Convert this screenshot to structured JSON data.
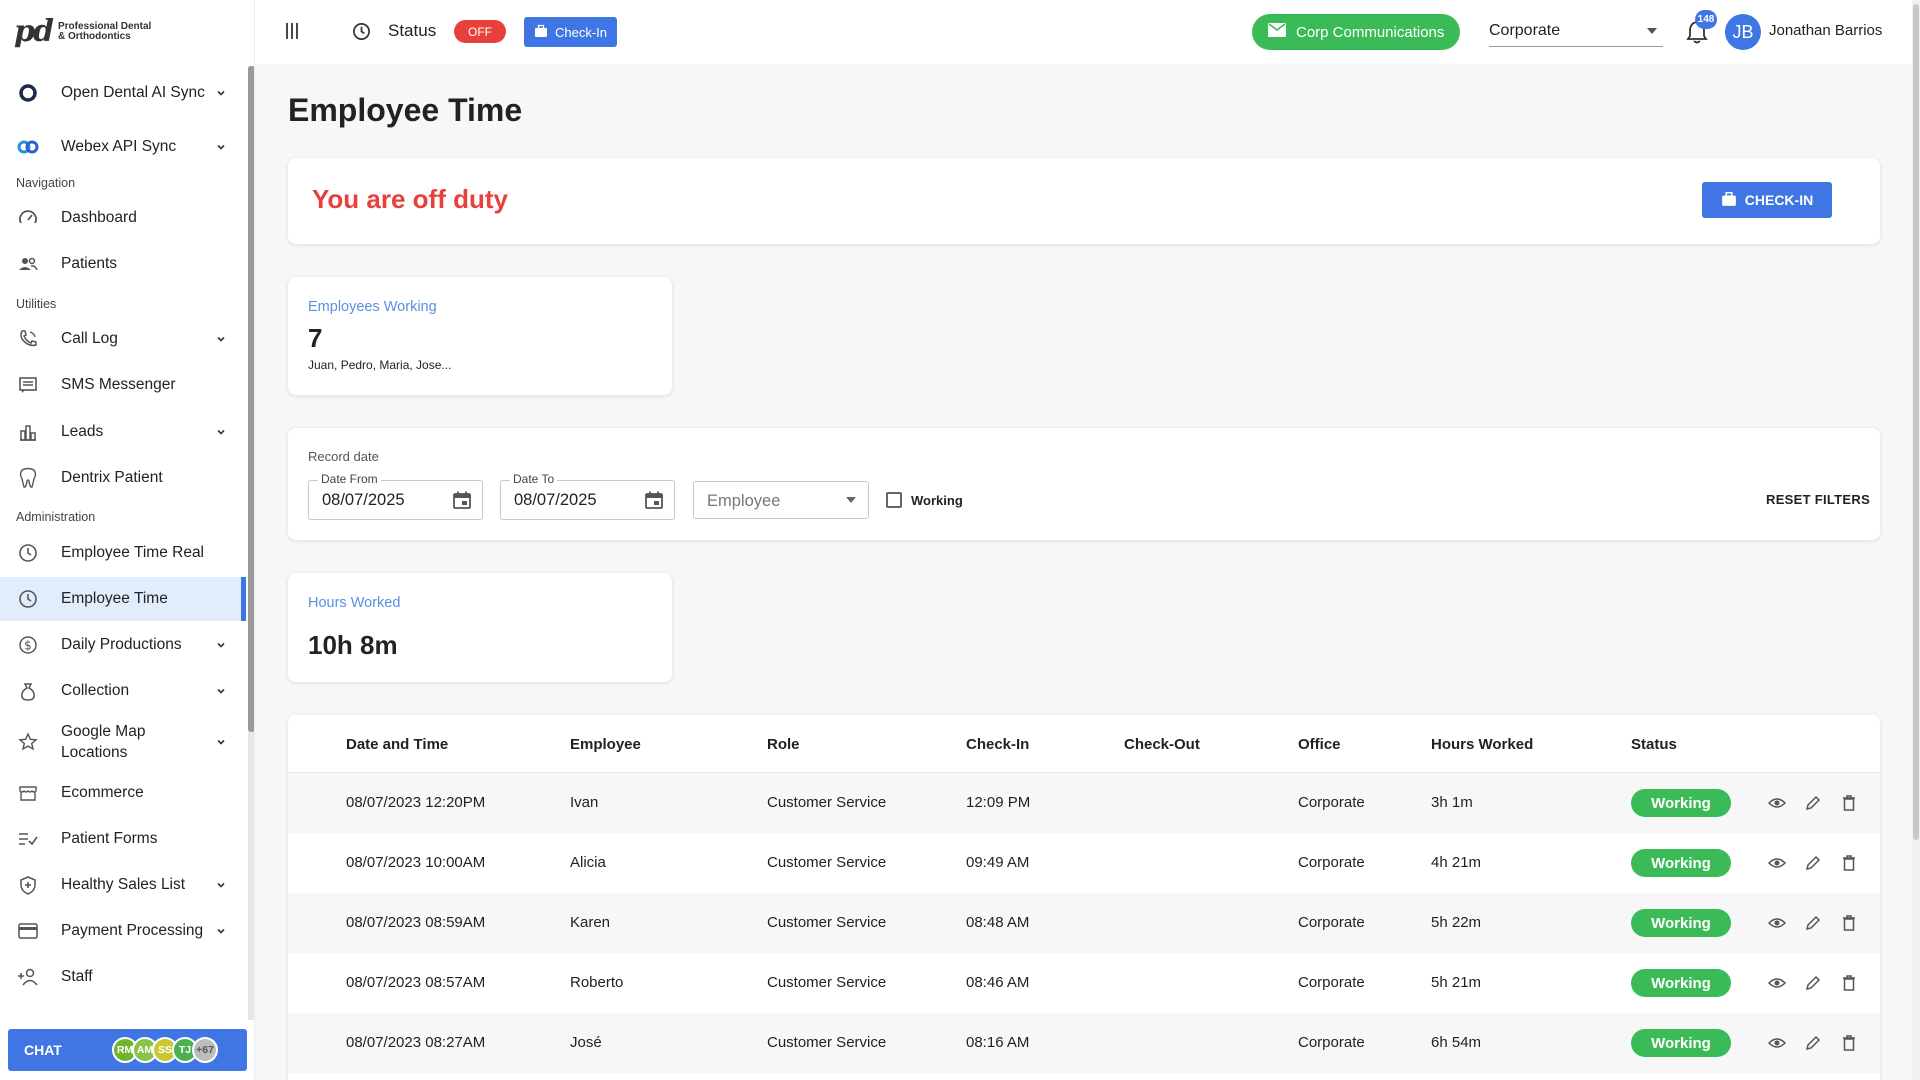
{
  "logo": {
    "mark": "pd",
    "line1": "Professional Dental",
    "line2": "& Orthodontics"
  },
  "sidebar": {
    "items": [
      {
        "label": "Open Dental AI Sync",
        "icon": "circle-ring-icon",
        "chevron": true
      },
      {
        "label": "Webex API Sync",
        "icon": "webex-icon",
        "chevron": true
      },
      {
        "label": "Dashboard",
        "icon": "speedometer-icon",
        "chevron": false
      },
      {
        "label": "Patients",
        "icon": "users-icon",
        "chevron": false
      },
      {
        "label": "Call Log",
        "icon": "phone-icon",
        "chevron": true
      },
      {
        "label": "SMS Messenger",
        "icon": "message-icon",
        "chevron": false
      },
      {
        "label": "Leads",
        "icon": "bar-chart-icon",
        "chevron": true
      },
      {
        "label": "Dentrix Patient",
        "icon": "tooth-icon",
        "chevron": false
      },
      {
        "label": "Employee Time Real",
        "icon": "clock-icon",
        "chevron": false
      },
      {
        "label": "Employee Time",
        "icon": "clock-icon",
        "chevron": false,
        "active": true
      },
      {
        "label": "Daily Productions",
        "icon": "dollar-icon",
        "chevron": true
      },
      {
        "label": "Collection",
        "icon": "money-bag-icon",
        "chevron": true
      },
      {
        "label": "Google Map Locations",
        "label_line1": "Google Map",
        "label_line2": "Locations",
        "icon": "star-icon",
        "chevron": true
      },
      {
        "label": "Ecommerce",
        "icon": "store-icon",
        "chevron": false
      },
      {
        "label": "Patient Forms",
        "icon": "checklist-icon",
        "chevron": false
      },
      {
        "label": "Healthy Sales List",
        "icon": "shield-icon",
        "chevron": true
      },
      {
        "label": "Payment Processing",
        "icon": "credit-card-icon",
        "chevron": true
      },
      {
        "label": "Staff",
        "icon": "add-person-icon",
        "chevron": false
      }
    ],
    "sections": {
      "navigation": "Navigation",
      "utilities": "Utilities",
      "administration": "Administration"
    },
    "chat": {
      "label": "CHAT",
      "avatars": [
        {
          "initials": "RM",
          "color": "#6fb52c"
        },
        {
          "initials": "AM",
          "color": "#8bc34a"
        },
        {
          "initials": "SS",
          "color": "#c9c832"
        },
        {
          "initials": "TJ",
          "color": "#4caf50"
        },
        {
          "initials": "+67",
          "color": "#bdbdbd"
        }
      ]
    }
  },
  "topbar": {
    "status_label": "Status",
    "status_value": "OFF",
    "checkin_label": "Check-In",
    "corp_comm_label": "Corp Communications",
    "office": "Corporate",
    "notifications": "148",
    "user_initials": "JB",
    "user_name": "Jonathan Barrios"
  },
  "page": {
    "title": "Employee Time",
    "duty_status": "You are off duty",
    "checkin_button": "CHECK-IN"
  },
  "stats": {
    "employees_working": {
      "label": "Employees Working",
      "value": "7",
      "names": "Juan, Pedro, Maria, Jose..."
    },
    "hours_worked": {
      "label": "Hours Worked",
      "value": "10h 8m"
    }
  },
  "filters": {
    "record_date_label": "Record date",
    "date_from": {
      "label": "Date From",
      "value": "08/07/2025"
    },
    "date_to": {
      "label": "Date To",
      "value": "08/07/2025"
    },
    "employee_placeholder": "Employee",
    "working_label": "Working",
    "working_checked": false,
    "reset_label": "RESET FILTERS"
  },
  "table": {
    "columns": [
      "Date and Time",
      "Employee",
      "Role",
      "Check-In",
      "Check-Out",
      "Office",
      "Hours Worked",
      "Status"
    ],
    "rows": [
      {
        "datetime": "08/07/2023 12:20PM",
        "employee": "Ivan",
        "role": "Customer Service",
        "checkin": "12:09 PM",
        "checkout": "",
        "office": "Corporate",
        "hours": "3h 1m",
        "status": "Working"
      },
      {
        "datetime": "08/07/2023 10:00AM",
        "employee": "Alicia",
        "role": "Customer Service",
        "checkin": "09:49 AM",
        "checkout": "",
        "office": "Corporate",
        "hours": "4h 21m",
        "status": "Working"
      },
      {
        "datetime": "08/07/2023 08:59AM",
        "employee": "Karen",
        "role": "Customer Service",
        "checkin": "08:48 AM",
        "checkout": "",
        "office": "Corporate",
        "hours": "5h 22m",
        "status": "Working"
      },
      {
        "datetime": "08/07/2023 08:57AM",
        "employee": "Roberto",
        "role": "Customer Service",
        "checkin": "08:46 AM",
        "checkout": "",
        "office": "Corporate",
        "hours": "5h 21m",
        "status": "Working"
      },
      {
        "datetime": "08/07/2023 08:27AM",
        "employee": "José",
        "role": "Customer Service",
        "checkin": "08:16 AM",
        "checkout": "",
        "office": "Corporate",
        "hours": "6h 54m",
        "status": "Working"
      }
    ]
  },
  "colors": {
    "primary": "#3f76e4",
    "success": "#3bbb57",
    "danger": "#e8413d",
    "active_bg": "#e1ecfc"
  }
}
